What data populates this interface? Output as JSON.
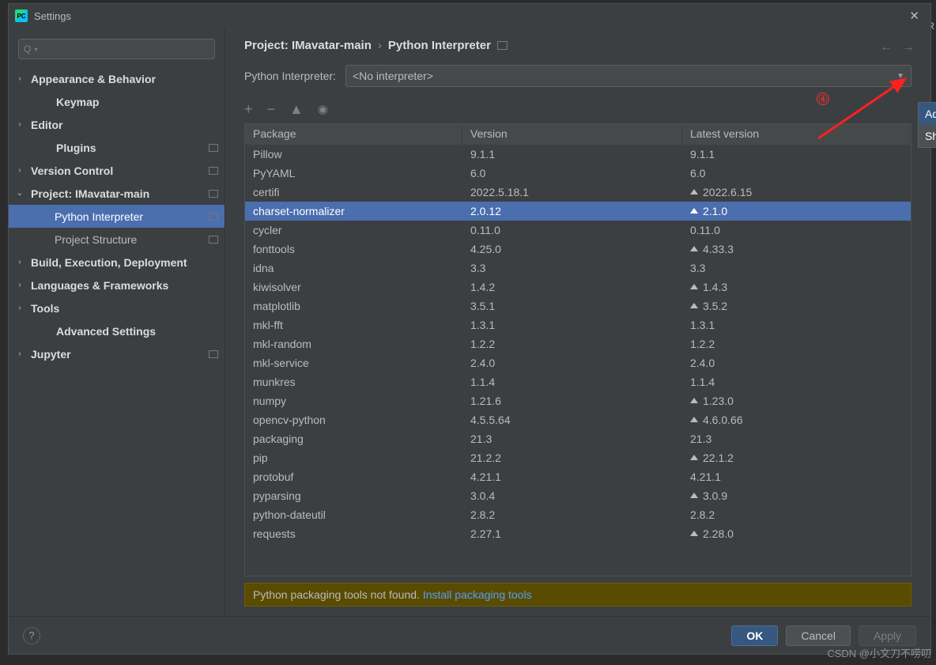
{
  "window": {
    "title": "Settings"
  },
  "search": {
    "placeholder": "Q▾"
  },
  "tree": {
    "items": [
      {
        "label": "Appearance & Behavior",
        "arrow": "›",
        "bold": true
      },
      {
        "label": "Keymap",
        "arrow": "",
        "bold": true,
        "plainchild": true
      },
      {
        "label": "Editor",
        "arrow": "›",
        "bold": true
      },
      {
        "label": "Plugins",
        "arrow": "",
        "bold": true,
        "plainchild": true,
        "icon": true
      },
      {
        "label": "Version Control",
        "arrow": "›",
        "bold": true,
        "icon": true
      },
      {
        "label": "Project: IMavatar-main",
        "arrow": "⌄",
        "bold": true,
        "icon": true
      },
      {
        "label": "Python Interpreter",
        "child": true,
        "selected": true,
        "icon": true
      },
      {
        "label": "Project Structure",
        "child": true,
        "icon": true
      },
      {
        "label": "Build, Execution, Deployment",
        "arrow": "›",
        "bold": true
      },
      {
        "label": "Languages & Frameworks",
        "arrow": "›",
        "bold": true
      },
      {
        "label": "Tools",
        "arrow": "›",
        "bold": true
      },
      {
        "label": "Advanced Settings",
        "arrow": "",
        "bold": true,
        "plainchild": true
      },
      {
        "label": "Jupyter",
        "arrow": "›",
        "bold": true,
        "icon": true
      }
    ]
  },
  "crumbs": {
    "a": "Project: IMavatar-main",
    "b": "Python Interpreter"
  },
  "interpreter": {
    "label": "Python Interpreter:",
    "value": "<No interpreter>"
  },
  "marker4": "④",
  "table": {
    "headers": {
      "pkg": "Package",
      "ver": "Version",
      "lat": "Latest version"
    },
    "rows": [
      {
        "pkg": "Pillow",
        "ver": "9.1.1",
        "lat": "9.1.1",
        "upg": false
      },
      {
        "pkg": "PyYAML",
        "ver": "6.0",
        "lat": "6.0",
        "upg": false
      },
      {
        "pkg": "certifi",
        "ver": "2022.5.18.1",
        "lat": "2022.6.15",
        "upg": true
      },
      {
        "pkg": "charset-normalizer",
        "ver": "2.0.12",
        "lat": "2.1.0",
        "upg": true,
        "sel": true
      },
      {
        "pkg": "cycler",
        "ver": "0.11.0",
        "lat": "0.11.0",
        "upg": false
      },
      {
        "pkg": "fonttools",
        "ver": "4.25.0",
        "lat": "4.33.3",
        "upg": true
      },
      {
        "pkg": "idna",
        "ver": "3.3",
        "lat": "3.3",
        "upg": false
      },
      {
        "pkg": "kiwisolver",
        "ver": "1.4.2",
        "lat": "1.4.3",
        "upg": true
      },
      {
        "pkg": "matplotlib",
        "ver": "3.5.1",
        "lat": "3.5.2",
        "upg": true
      },
      {
        "pkg": "mkl-fft",
        "ver": "1.3.1",
        "lat": "1.3.1",
        "upg": false
      },
      {
        "pkg": "mkl-random",
        "ver": "1.2.2",
        "lat": "1.2.2",
        "upg": false
      },
      {
        "pkg": "mkl-service",
        "ver": "2.4.0",
        "lat": "2.4.0",
        "upg": false
      },
      {
        "pkg": "munkres",
        "ver": "1.1.4",
        "lat": "1.1.4",
        "upg": false
      },
      {
        "pkg": "numpy",
        "ver": "1.21.6",
        "lat": "1.23.0",
        "upg": true
      },
      {
        "pkg": "opencv-python",
        "ver": "4.5.5.64",
        "lat": "4.6.0.66",
        "upg": true
      },
      {
        "pkg": "packaging",
        "ver": "21.3",
        "lat": "21.3",
        "upg": false
      },
      {
        "pkg": "pip",
        "ver": "21.2.2",
        "lat": "22.1.2",
        "upg": true
      },
      {
        "pkg": "protobuf",
        "ver": "4.21.1",
        "lat": "4.21.1",
        "upg": false
      },
      {
        "pkg": "pyparsing",
        "ver": "3.0.4",
        "lat": "3.0.9",
        "upg": true
      },
      {
        "pkg": "python-dateutil",
        "ver": "2.8.2",
        "lat": "2.8.2",
        "upg": false
      },
      {
        "pkg": "requests",
        "ver": "2.27.1",
        "lat": "2.28.0",
        "upg": true
      }
    ]
  },
  "banner": {
    "text": "Python packaging tools not found. ",
    "link": "Install packaging tools"
  },
  "sidemenu": {
    "add": "Add...",
    "show": "Show"
  },
  "footer": {
    "ok": "OK",
    "cancel": "Cancel",
    "apply": "Apply"
  },
  "watermark": "CSDN @小文刀不唠叨",
  "small_r": "R"
}
